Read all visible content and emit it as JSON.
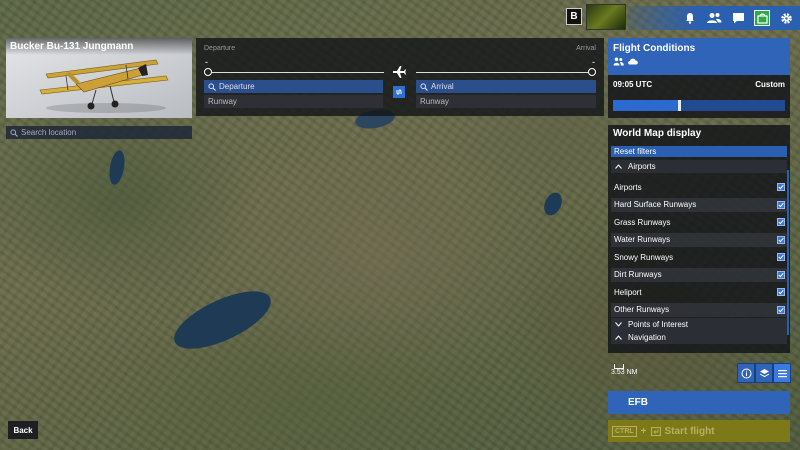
{
  "aircraft": {
    "name": "Bucker Bu-131 Jungmann"
  },
  "search_location": {
    "placeholder": "Search location"
  },
  "topbar": {
    "key_hint": "B",
    "icons": [
      "bell-icon",
      "friends-icon",
      "chat-icon",
      "marketplace-icon",
      "settings-icon"
    ]
  },
  "route": {
    "departure_label": "Departure",
    "arrival_label": "Arrival",
    "departure_code": "-",
    "arrival_code": "-",
    "departure_field": "Departure",
    "arrival_field": "Arrival",
    "departure_runway": "Runway",
    "arrival_runway": "Runway"
  },
  "conditions": {
    "title": "Flight Conditions",
    "time": "09:05 UTC",
    "preset": "Custom",
    "time_of_day_fraction": 0.38
  },
  "world_map": {
    "title": "World Map display",
    "reset": "Reset filters",
    "sections": {
      "airports": "Airports",
      "poi": "Points of Interest",
      "navigation": "Navigation"
    },
    "filters": [
      {
        "label": "Airports",
        "checked": true
      },
      {
        "label": "Hard Surface Runways",
        "checked": true
      },
      {
        "label": "Grass Runways",
        "checked": true
      },
      {
        "label": "Water Runways",
        "checked": true
      },
      {
        "label": "Snowy Runways",
        "checked": true
      },
      {
        "label": "Dirt Runways",
        "checked": true
      },
      {
        "label": "Heliport",
        "checked": true
      },
      {
        "label": "Other Runways",
        "checked": true
      }
    ]
  },
  "map": {
    "scale": "3.53 NM"
  },
  "actions": {
    "efb": "EFB",
    "start_key": "CTRL",
    "start_plus": "+",
    "start": "Start flight",
    "back": "Back"
  },
  "colors": {
    "accent_blue": "#2f64b8",
    "start_button": "#7d7818",
    "panel_bg": "#141619"
  }
}
